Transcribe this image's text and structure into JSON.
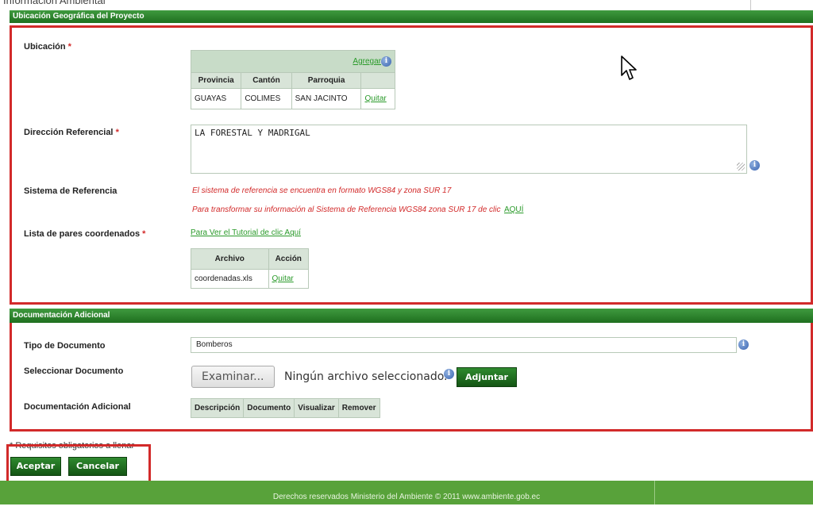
{
  "page": {
    "top_title": "Información Ambiental"
  },
  "ubicacion_section": {
    "title": "Ubicación Geográfica del Proyecto",
    "ubicacion_label": "Ubicación",
    "required_mark": "*",
    "location_table": {
      "add_link": "Agregar",
      "headers": [
        "Provincia",
        "Cantón",
        "Parroquia",
        ""
      ],
      "row": {
        "provincia": "GUAYAS",
        "canton": "COLIMES",
        "parroquia": "SAN JACINTO",
        "action": "Quitar"
      }
    },
    "direccion_label": "Dirección Referencial",
    "direccion_value": "LA FORESTAL Y MADRIGAL",
    "sistema_label": "Sistema de Referencia",
    "sistema_line1": "El sistema de referencia se encuentra en formato WGS84 y zona SUR 17",
    "sistema_line2": "Para transformar su información al Sistema de Referencia WGS84 zona SUR 17 de clic",
    "sistema_link": "AQUÍ",
    "lista_label": "Lista de pares coordenados",
    "tutorial_link": "Para Ver el Tutorial de clic Aquí",
    "file_table": {
      "headers": [
        "Archivo",
        "Acción"
      ],
      "row": {
        "archivo": "coordenadas.xls",
        "action": "Quitar"
      }
    }
  },
  "documentacion_section": {
    "title": "Documentación Adicional",
    "tipo_label": "Tipo de Documento",
    "tipo_value": "Bomberos",
    "seleccionar_label": "Seleccionar Documento",
    "browse_button": "Examinar...",
    "file_status": "Ningún archivo seleccionado.",
    "adjuntar_button": "Adjuntar",
    "doc_label": "Documentación Adicional",
    "doc_table_headers": [
      "Descripción",
      "Documento",
      "Visualizar",
      "Remover"
    ]
  },
  "form_footer": {
    "required_note": "* Requisitos obligatorios a llenar",
    "aceptar_button": "Aceptar",
    "cancelar_button": "Cancelar"
  },
  "footer": {
    "copyright": "Derechos reservados Ministerio del Ambiente © 2011 www.ambiente.gob.ec"
  },
  "colors": {
    "header_green": "#1f6f1f",
    "link_green": "#2a9a2a",
    "highlight_red": "#d22a2a",
    "footer_green": "#58a23a"
  },
  "icons": [
    "info-icon",
    "mouse-cursor-icon",
    "resize-grip-icon"
  ]
}
